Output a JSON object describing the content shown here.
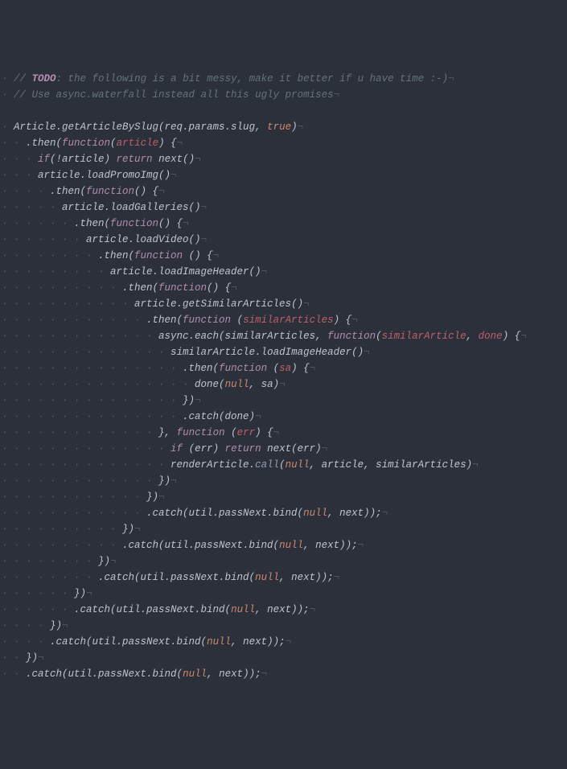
{
  "lines": [
    {
      "indent": 1,
      "tokens": [
        {
          "t": "// ",
          "c": "comment"
        },
        {
          "t": "TODO",
          "c": "todo"
        },
        {
          "t": ": the following is a bit messy, make it better if u have time :-)",
          "c": "comment"
        },
        {
          "t": "¬",
          "c": "invis"
        }
      ]
    },
    {
      "indent": 1,
      "tokens": [
        {
          "t": "// Use async.waterfall instead all this ugly promises",
          "c": "comment"
        },
        {
          "t": "¬",
          "c": "invis"
        }
      ]
    },
    {
      "indent": 0,
      "tokens": []
    },
    {
      "indent": 1,
      "tokens": [
        {
          "t": "Article.getArticleBySlug(req.params.slug, ",
          "c": "p"
        },
        {
          "t": "true",
          "c": "bool"
        },
        {
          "t": ")",
          "c": "p"
        },
        {
          "t": "¬",
          "c": "invis"
        }
      ]
    },
    {
      "indent": 2,
      "tokens": [
        {
          "t": ".then(",
          "c": "p"
        },
        {
          "t": "function",
          "c": "fnk"
        },
        {
          "t": "(",
          "c": "p"
        },
        {
          "t": "article",
          "c": "fn"
        },
        {
          "t": ") {",
          "c": "p"
        },
        {
          "t": "¬",
          "c": "invis"
        }
      ]
    },
    {
      "indent": 3,
      "tokens": [
        {
          "t": "if",
          "c": "kw"
        },
        {
          "t": "(!article) ",
          "c": "p"
        },
        {
          "t": "return",
          "c": "kw"
        },
        {
          "t": " next()",
          "c": "p"
        },
        {
          "t": "¬",
          "c": "invis"
        }
      ]
    },
    {
      "indent": 3,
      "tokens": [
        {
          "t": "article.loadPromoImg()",
          "c": "p"
        },
        {
          "t": "¬",
          "c": "invis"
        }
      ]
    },
    {
      "indent": 4,
      "tokens": [
        {
          "t": ".then(",
          "c": "p"
        },
        {
          "t": "function",
          "c": "fnk"
        },
        {
          "t": "() {",
          "c": "p"
        },
        {
          "t": "¬",
          "c": "invis"
        }
      ]
    },
    {
      "indent": 5,
      "tokens": [
        {
          "t": "article.loadGalleries()",
          "c": "p"
        },
        {
          "t": "¬",
          "c": "invis"
        }
      ]
    },
    {
      "indent": 6,
      "tokens": [
        {
          "t": ".then(",
          "c": "p"
        },
        {
          "t": "function",
          "c": "fnk"
        },
        {
          "t": "() {",
          "c": "p"
        },
        {
          "t": "¬",
          "c": "invis"
        }
      ]
    },
    {
      "indent": 7,
      "tokens": [
        {
          "t": "article.loadVideo()",
          "c": "p"
        },
        {
          "t": "¬",
          "c": "invis"
        }
      ]
    },
    {
      "indent": 8,
      "tokens": [
        {
          "t": ".then(",
          "c": "p"
        },
        {
          "t": "function",
          "c": "fnk"
        },
        {
          "t": " () {",
          "c": "p"
        },
        {
          "t": "¬",
          "c": "invis"
        }
      ]
    },
    {
      "indent": 9,
      "tokens": [
        {
          "t": "article.loadImageHeader()",
          "c": "p"
        },
        {
          "t": "¬",
          "c": "invis"
        }
      ]
    },
    {
      "indent": 10,
      "tokens": [
        {
          "t": ".then(",
          "c": "p"
        },
        {
          "t": "function",
          "c": "fnk"
        },
        {
          "t": "() {",
          "c": "p"
        },
        {
          "t": "¬",
          "c": "invis"
        }
      ]
    },
    {
      "indent": 11,
      "tokens": [
        {
          "t": "article.getSimilarArticles()",
          "c": "p"
        },
        {
          "t": "¬",
          "c": "invis"
        }
      ]
    },
    {
      "indent": 12,
      "tokens": [
        {
          "t": ".then(",
          "c": "p"
        },
        {
          "t": "function",
          "c": "fnk"
        },
        {
          "t": " (",
          "c": "p"
        },
        {
          "t": "similarArticles",
          "c": "fn"
        },
        {
          "t": ") {",
          "c": "p"
        },
        {
          "t": "¬",
          "c": "invis"
        }
      ]
    },
    {
      "indent": 13,
      "tokens": [
        {
          "t": "async.each(similarArticles, ",
          "c": "p"
        },
        {
          "t": "function",
          "c": "fnk"
        },
        {
          "t": "(",
          "c": "p"
        },
        {
          "t": "similarArticle",
          "c": "fn"
        },
        {
          "t": ", ",
          "c": "p"
        },
        {
          "t": "done",
          "c": "fn"
        },
        {
          "t": ") {",
          "c": "p"
        },
        {
          "t": "¬",
          "c": "invis"
        }
      ]
    },
    {
      "indent": 14,
      "tokens": [
        {
          "t": "similarArticle.loadImageHeader()",
          "c": "p"
        },
        {
          "t": "¬",
          "c": "invis"
        }
      ]
    },
    {
      "indent": 15,
      "tokens": [
        {
          "t": ".then(",
          "c": "p"
        },
        {
          "t": "function",
          "c": "fnk"
        },
        {
          "t": " (",
          "c": "p"
        },
        {
          "t": "sa",
          "c": "fn"
        },
        {
          "t": ") {",
          "c": "p"
        },
        {
          "t": "¬",
          "c": "invis"
        }
      ]
    },
    {
      "indent": 16,
      "tokens": [
        {
          "t": "done(",
          "c": "p"
        },
        {
          "t": "null",
          "c": "null"
        },
        {
          "t": ", sa)",
          "c": "p"
        },
        {
          "t": "¬",
          "c": "invis"
        }
      ]
    },
    {
      "indent": 15,
      "tokens": [
        {
          "t": "})",
          "c": "p"
        },
        {
          "t": "¬",
          "c": "invis"
        }
      ]
    },
    {
      "indent": 15,
      "tokens": [
        {
          "t": ".catch(done)",
          "c": "p"
        },
        {
          "t": "¬",
          "c": "invis"
        }
      ]
    },
    {
      "indent": 13,
      "tokens": [
        {
          "t": "}, ",
          "c": "p"
        },
        {
          "t": "function",
          "c": "fnk"
        },
        {
          "t": " (",
          "c": "p"
        },
        {
          "t": "err",
          "c": "fn"
        },
        {
          "t": ") {",
          "c": "p"
        },
        {
          "t": "¬",
          "c": "invis"
        }
      ]
    },
    {
      "indent": 14,
      "tokens": [
        {
          "t": "if",
          "c": "kw"
        },
        {
          "t": " (err) ",
          "c": "p"
        },
        {
          "t": "return",
          "c": "kw"
        },
        {
          "t": " next(err)",
          "c": "p"
        },
        {
          "t": "¬",
          "c": "invis"
        }
      ]
    },
    {
      "indent": 14,
      "tokens": [
        {
          "t": "renderArticle.",
          "c": "p"
        },
        {
          "t": "call",
          "c": "call-accent"
        },
        {
          "t": "(",
          "c": "p"
        },
        {
          "t": "null",
          "c": "null"
        },
        {
          "t": ", article, similarArticles)",
          "c": "p"
        },
        {
          "t": "¬",
          "c": "invis"
        }
      ]
    },
    {
      "indent": 13,
      "tokens": [
        {
          "t": "})",
          "c": "p"
        },
        {
          "t": "¬",
          "c": "invis"
        }
      ]
    },
    {
      "indent": 12,
      "tokens": [
        {
          "t": "})",
          "c": "p"
        },
        {
          "t": "¬",
          "c": "invis"
        }
      ]
    },
    {
      "indent": 12,
      "tokens": [
        {
          "t": ".catch(util.passNext.bind(",
          "c": "p"
        },
        {
          "t": "null",
          "c": "null"
        },
        {
          "t": ", next));",
          "c": "p"
        },
        {
          "t": "¬",
          "c": "invis"
        }
      ]
    },
    {
      "indent": 10,
      "tokens": [
        {
          "t": "})",
          "c": "p"
        },
        {
          "t": "¬",
          "c": "invis"
        }
      ]
    },
    {
      "indent": 10,
      "tokens": [
        {
          "t": ".catch(util.passNext.bind(",
          "c": "p"
        },
        {
          "t": "null",
          "c": "null"
        },
        {
          "t": ", next));",
          "c": "p"
        },
        {
          "t": "¬",
          "c": "invis"
        }
      ]
    },
    {
      "indent": 8,
      "tokens": [
        {
          "t": "})",
          "c": "p"
        },
        {
          "t": "¬",
          "c": "invis"
        }
      ]
    },
    {
      "indent": 8,
      "tokens": [
        {
          "t": ".catch(util.passNext.bind(",
          "c": "p"
        },
        {
          "t": "null",
          "c": "null"
        },
        {
          "t": ", next));",
          "c": "p"
        },
        {
          "t": "¬",
          "c": "invis"
        }
      ]
    },
    {
      "indent": 6,
      "tokens": [
        {
          "t": "})",
          "c": "p"
        },
        {
          "t": "¬",
          "c": "invis"
        }
      ]
    },
    {
      "indent": 6,
      "tokens": [
        {
          "t": ".catch(util.passNext.bind(",
          "c": "p"
        },
        {
          "t": "null",
          "c": "null"
        },
        {
          "t": ", next));",
          "c": "p"
        },
        {
          "t": "¬",
          "c": "invis"
        }
      ]
    },
    {
      "indent": 4,
      "tokens": [
        {
          "t": "})",
          "c": "p"
        },
        {
          "t": "¬",
          "c": "invis"
        }
      ]
    },
    {
      "indent": 4,
      "tokens": [
        {
          "t": ".catch(util.passNext.bind(",
          "c": "p"
        },
        {
          "t": "null",
          "c": "null"
        },
        {
          "t": ", next));",
          "c": "p"
        },
        {
          "t": "¬",
          "c": "invis"
        }
      ]
    },
    {
      "indent": 2,
      "tokens": [
        {
          "t": "})",
          "c": "p"
        },
        {
          "t": "¬",
          "c": "invis"
        }
      ]
    },
    {
      "indent": 2,
      "tokens": [
        {
          "t": ".catch(util.passNext.bind(",
          "c": "p"
        },
        {
          "t": "null",
          "c": "null"
        },
        {
          "t": ", next));",
          "c": "p"
        },
        {
          "t": "¬",
          "c": "invis"
        }
      ]
    }
  ],
  "indent_glyph": "·",
  "indent_width": 2
}
